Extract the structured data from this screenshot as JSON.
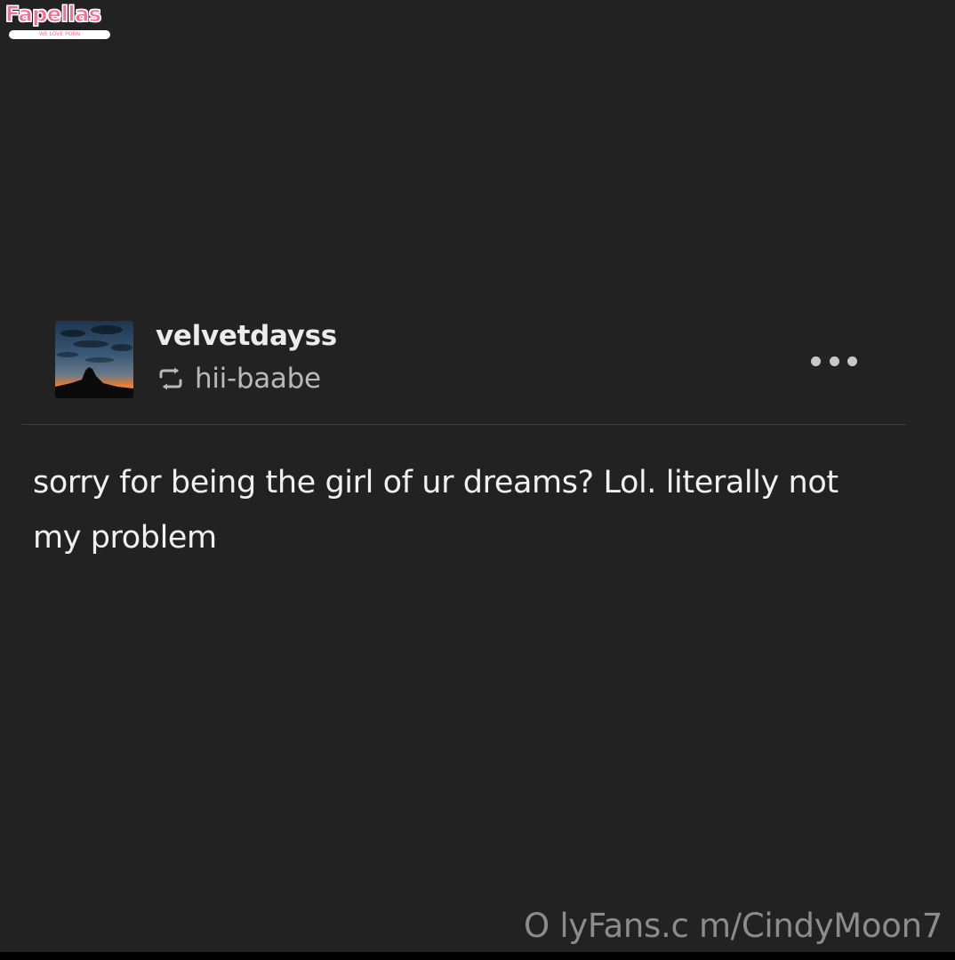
{
  "watermark": {
    "brand": "Fapellas",
    "tagline": "WE LOVE PORN",
    "footer_text": "O lyFans.c m/CindyMoon7"
  },
  "post": {
    "username": "velvetdayss",
    "reblogged_from": "hii-baabe",
    "reblog_icon": "reblog-icon",
    "more_icon": "more-dots-icon",
    "body_line1": "sorry for being the girl of ur dreams? Lol. literally not",
    "body_line2": "my problem"
  },
  "colors": {
    "background": "#222222",
    "text": "#f0f0f0",
    "secondary_text": "#b9b9b9",
    "brand_pink": "#ff6b8f"
  }
}
